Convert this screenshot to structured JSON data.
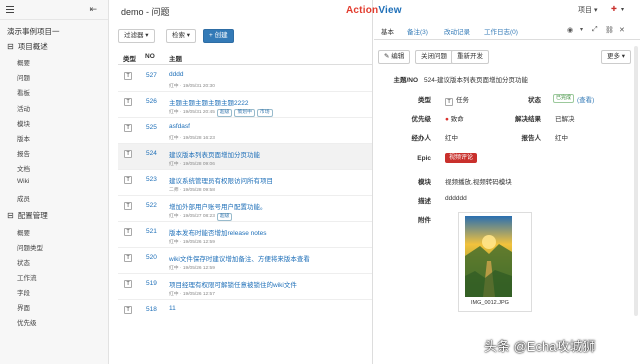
{
  "sidebar": {
    "project": "演示事例项目一",
    "groups": [
      {
        "label": "项目概述",
        "items": [
          "概要",
          "问题",
          "看板",
          "活动",
          "模块",
          "版本",
          "报告",
          "文档",
          "Wiki",
          "成员"
        ]
      },
      {
        "label": "配置管理",
        "items": [
          "概要",
          "问题类型",
          "状态",
          "工作流",
          "字段",
          "界面",
          "优先级"
        ]
      }
    ]
  },
  "list": {
    "title": "demo - 问题",
    "filter_label": "过滤器 ▾",
    "search_label": "检索 ▾",
    "create_label": "+ 创建",
    "columns": [
      "类型",
      "NO",
      "主题"
    ],
    "rows": [
      {
        "type": "T",
        "no": "527",
        "title": "dddd",
        "sub": "红中 · 19/05/31 20:30",
        "tags": []
      },
      {
        "type": "T",
        "no": "526",
        "title": "主题主题主题主题主题2222",
        "sub": "红中 · 19/05/31 20:45",
        "tags": [
          "超级",
          "策划中",
          "市场"
        ]
      },
      {
        "type": "T",
        "no": "525",
        "title": "asfdasf",
        "sub": "红中 · 19/05/28 16:23",
        "tags": []
      },
      {
        "type": "T",
        "no": "524",
        "title": "建议版本列表页面增加分页功能",
        "sub": "红中 · 19/05/28 09:06",
        "tags": []
      },
      {
        "type": "T",
        "no": "523",
        "title": "建议系统管理员有权限访问所有项目",
        "sub": "二师 · 19/05/28 09:58",
        "tags": []
      },
      {
        "type": "T",
        "no": "522",
        "title": "增加外部用户账号用户配置功能。",
        "sub": "红中 · 19/05/27 08:23",
        "tags": [
          "超级"
        ]
      },
      {
        "type": "T",
        "no": "521",
        "title": "版本发布时能否增加release notes",
        "sub": "红中 · 19/05/26 12:59",
        "tags": []
      },
      {
        "type": "T",
        "no": "520",
        "title": "wiki文件保存时建议增加备注、方便将来版本查看",
        "sub": "红中 · 19/05/26 12:59",
        "tags": []
      },
      {
        "type": "T",
        "no": "519",
        "title": "项目经理有权限可解锁任意被锁住的wiki文件",
        "sub": "红中 · 19/05/26 12:57",
        "tags": []
      },
      {
        "type": "T",
        "no": "518",
        "title": "11",
        "sub": "",
        "tags": []
      }
    ]
  },
  "topbar": {
    "logo_part1": "Action",
    "logo_part2": "View",
    "project_menu": "项目 ▾",
    "user_menu": "▾"
  },
  "detail": {
    "tabs": [
      "基本",
      "备注(3)",
      "改动记录",
      "工作日志(0)"
    ],
    "actions": [
      "✎ 编辑",
      "关闭问题",
      "重新开发"
    ],
    "more_label": "更多 ▾",
    "fields": {
      "subject_label": "主题/NO",
      "subject_value": "524-建议版本列表页面增加分页功能",
      "type_label": "类型",
      "type_value": "任务",
      "status_label": "状态",
      "status_badge": "已完成",
      "status_link": "(查看)",
      "priority_label": "优先级",
      "priority_value": "致命",
      "resolution_label": "解决结果",
      "resolution_value": "已解决",
      "assignee_label": "经办人",
      "assignee_value": "红中",
      "reporter_label": "报告人",
      "reporter_value": "红中",
      "epic_label": "Epic",
      "epic_value": "视频评论",
      "module_label": "模块",
      "module_value": "视频播放,视频转码模块",
      "desc_label": "描述",
      "desc_value": "dddddd",
      "attach_label": "附件",
      "attach_name": "IMG_0012.JPG"
    }
  },
  "watermark": "头条 @Echa攻城狮",
  "colors": {
    "accent": "#337ab7",
    "danger": "#c9302c",
    "link": "#1e6fb8"
  }
}
